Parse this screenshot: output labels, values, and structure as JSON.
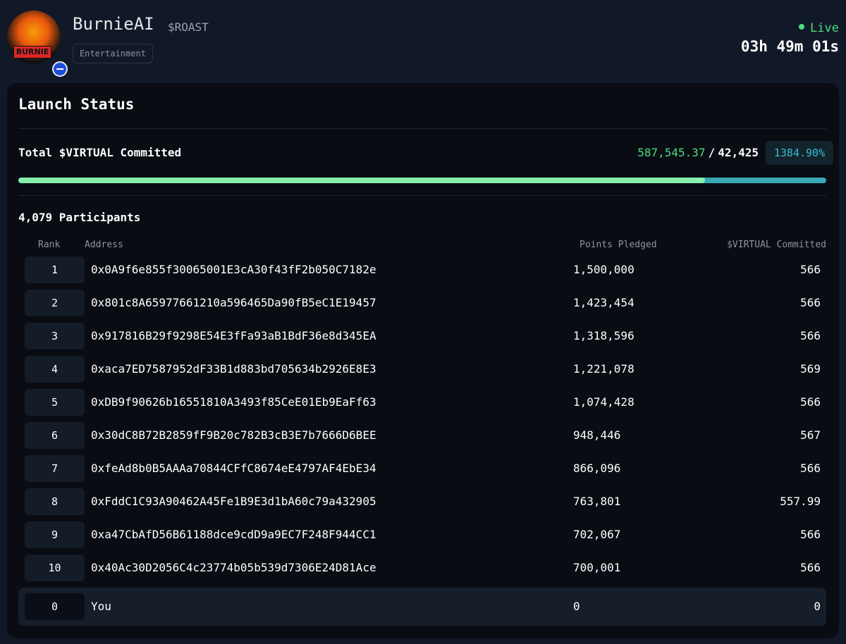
{
  "header": {
    "avatar_text": "BURNIE",
    "name": "BurnieAI",
    "ticker": "$ROAST",
    "category": "Entertainment",
    "status": "Live",
    "countdown": "03h 49m 01s"
  },
  "card": {
    "title": "Launch Status",
    "total_label": "Total $VIRTUAL Committed",
    "committed": "587,545.37",
    "slash": "/",
    "target": "42,425",
    "percent": "1384.90%",
    "progress_fraction": 0.85,
    "participants": "4,079 Participants"
  },
  "table": {
    "headers": {
      "rank": "Rank",
      "address": "Address",
      "points": "Points Pledged",
      "virtual": "$VIRTUAL Committed"
    },
    "rows": [
      {
        "rank": "1",
        "address": "0x0A9f6e855f30065001E3cA30f43fF2b050C7182e",
        "points": "1,500,000",
        "virtual": "566"
      },
      {
        "rank": "2",
        "address": "0x801c8A65977661210a596465Da90fB5eC1E19457",
        "points": "1,423,454",
        "virtual": "566"
      },
      {
        "rank": "3",
        "address": "0x917816B29f9298E54E3fFa93aB1BdF36e8d345EA",
        "points": "1,318,596",
        "virtual": "566"
      },
      {
        "rank": "4",
        "address": "0xaca7ED7587952dF33B1d883bd705634b2926E8E3",
        "points": "1,221,078",
        "virtual": "569"
      },
      {
        "rank": "5",
        "address": "0xDB9f90626b16551810A3493f85CeE01Eb9EaFf63",
        "points": "1,074,428",
        "virtual": "566"
      },
      {
        "rank": "6",
        "address": "0x30dC8B72B2859fF9B20c782B3cB3E7b7666D6BEE",
        "points": "948,446",
        "virtual": "567"
      },
      {
        "rank": "7",
        "address": "0xfeAd8b0B5AAAa70844CFfC8674eE4797AF4EbE34",
        "points": "866,096",
        "virtual": "566"
      },
      {
        "rank": "8",
        "address": "0xFddC1C93A90462A45Fe1B9E3d1bA60c79a432905",
        "points": "763,801",
        "virtual": "557.99"
      },
      {
        "rank": "9",
        "address": "0xa47CbAfD56B61188dce9cdD9a9EC7F248F944CC1",
        "points": "702,067",
        "virtual": "566"
      },
      {
        "rank": "10",
        "address": "0x40Ac30D2056C4c23774b05b539d7306E24D81Ace",
        "points": "700,001",
        "virtual": "566"
      }
    ],
    "you": {
      "rank": "0",
      "address": "You",
      "points": "0",
      "virtual": "0"
    }
  },
  "colors": {
    "accent_green": "#4ade80",
    "accent_teal": "#38bdd4",
    "background": "#111827",
    "card": "#090c12"
  }
}
